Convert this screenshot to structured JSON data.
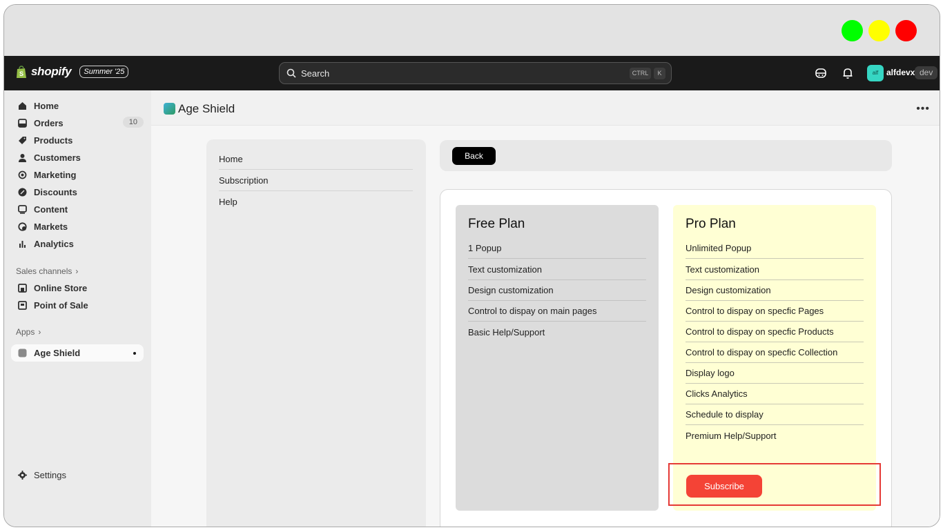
{
  "window": {
    "controls": {
      "green": "#00ff00",
      "yellow": "#ffff00",
      "red": "#ff0000"
    }
  },
  "topbar": {
    "logo_text": "shopify",
    "edition_badge": "Summer '25",
    "search_placeholder": "Search",
    "shortcut_key1": "CTRL",
    "shortcut_key2": "K",
    "avatar_initials": "alf",
    "store_name": "alfdevx",
    "env_badge": "dev"
  },
  "sidebar": {
    "items": [
      {
        "label": "Home",
        "icon": "home-icon"
      },
      {
        "label": "Orders",
        "icon": "orders-icon",
        "count": "10"
      },
      {
        "label": "Products",
        "icon": "tag-icon"
      },
      {
        "label": "Customers",
        "icon": "person-icon"
      },
      {
        "label": "Marketing",
        "icon": "target-icon"
      },
      {
        "label": "Discounts",
        "icon": "discount-icon"
      },
      {
        "label": "Content",
        "icon": "content-icon"
      },
      {
        "label": "Markets",
        "icon": "globe-icon"
      },
      {
        "label": "Analytics",
        "icon": "bar-chart-icon"
      }
    ],
    "sales_channels_title": "Sales channels",
    "sales_channels": [
      {
        "label": "Online Store",
        "icon": "store-icon"
      },
      {
        "label": "Point of Sale",
        "icon": "pos-icon"
      }
    ],
    "apps_title": "Apps",
    "apps": [
      {
        "label": "Age Shield",
        "icon": "app-icon"
      }
    ],
    "settings_label": "Settings"
  },
  "page": {
    "title": "Age Shield",
    "more_icon": "more-horizontal-icon"
  },
  "app_nav": {
    "items": [
      "Home",
      "Subscription",
      "Help"
    ]
  },
  "back_label": "Back",
  "plans": {
    "free": {
      "title": "Free Plan",
      "features": [
        "1 Popup",
        "Text customization",
        "Design customization",
        "Control to dispay on main pages",
        "Basic Help/Support"
      ]
    },
    "pro": {
      "title": "Pro Plan",
      "features": [
        "Unlimited Popup",
        "Text customization",
        "Design customization",
        "Control to dispay on specfic Pages",
        "Control to dispay on specfic Products",
        "Control to dispay on specfic Collection",
        "Display logo",
        "Clicks Analytics",
        "Schedule to display",
        "Premium Help/Support"
      ],
      "subscribe_label": "Subscribe"
    }
  }
}
